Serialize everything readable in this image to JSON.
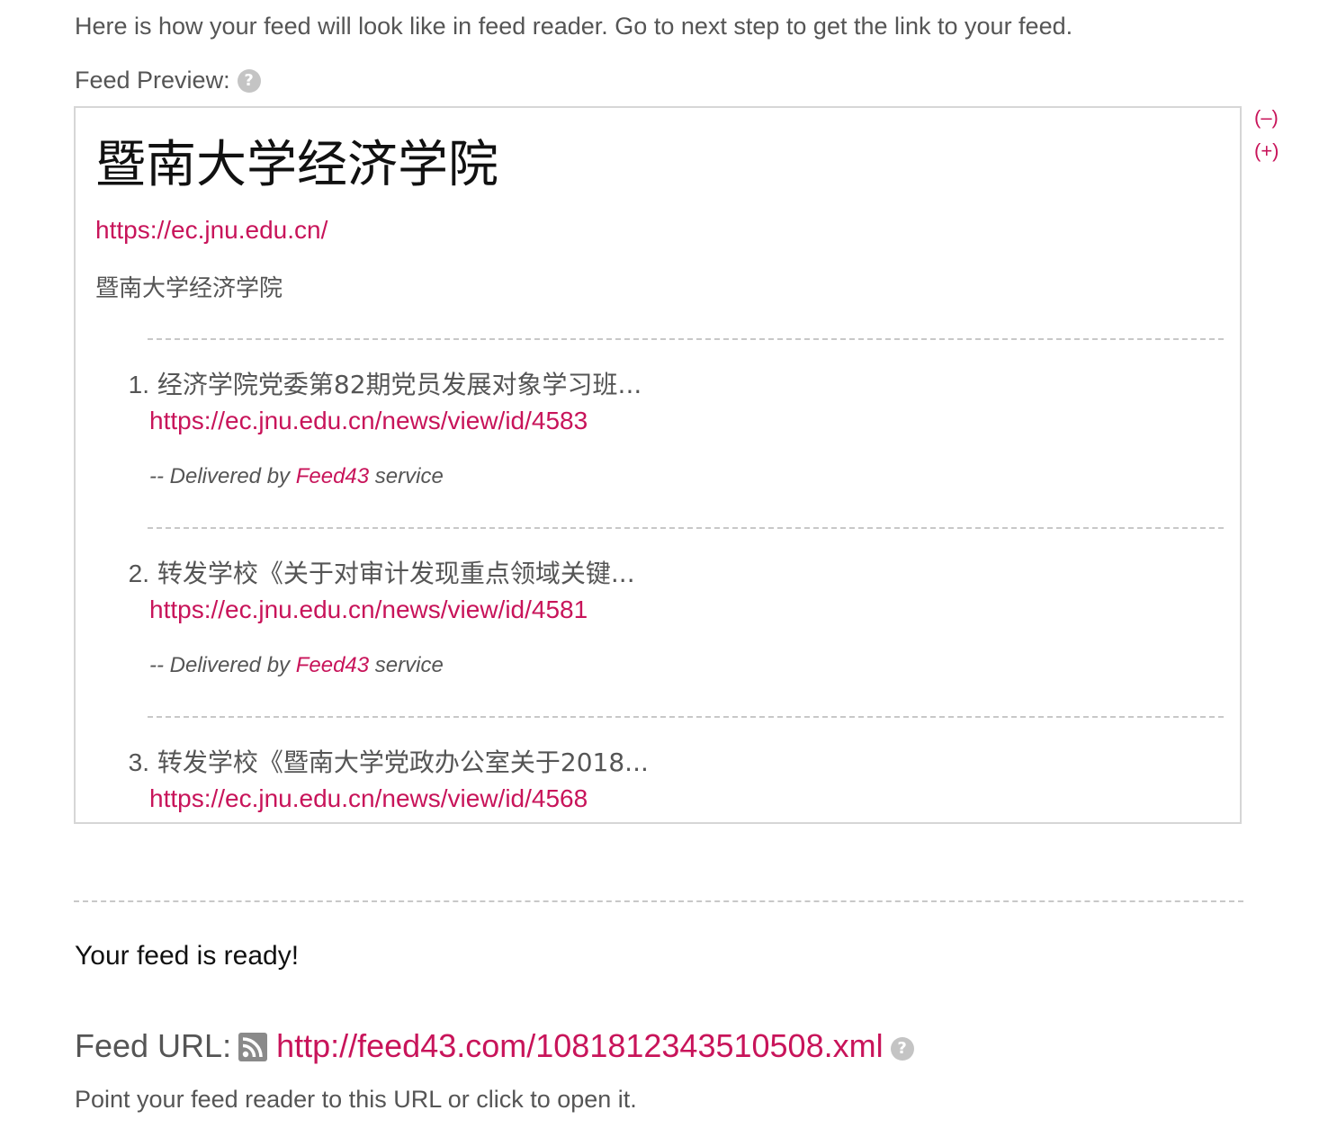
{
  "intro_text": "Here is how your feed will look like in feed reader. Go to next step to get the link to your feed.",
  "preview_label": "Feed Preview:",
  "help_icon_glyph": "?",
  "zoom": {
    "minus": "(–)",
    "plus": "(+)"
  },
  "feed": {
    "title": "暨南大学经济学院",
    "link": "https://ec.jnu.edu.cn/",
    "description": "暨南大学经济学院",
    "items": [
      {
        "number": "1.",
        "title": "经济学院党委第82期党员发展对象学习班...",
        "url": "https://ec.jnu.edu.cn/news/view/id/4583",
        "delivered_prefix": "-- Delivered by ",
        "delivered_link": "Feed43",
        "delivered_suffix": " service"
      },
      {
        "number": "2.",
        "title": "转发学校《关于对审计发现重点领域关键...",
        "url": "https://ec.jnu.edu.cn/news/view/id/4581",
        "delivered_prefix": "-- Delivered by ",
        "delivered_link": "Feed43",
        "delivered_suffix": " service"
      },
      {
        "number": "3.",
        "title": "转发学校《暨南大学党政办公室关于2018...",
        "url": "https://ec.jnu.edu.cn/news/view/id/4568"
      }
    ]
  },
  "ready_text": "Your feed is ready!",
  "feed_url_label": "Feed URL:",
  "feed_url": "http://feed43.com/1081812343510508.xml",
  "hint_text": "Point your feed reader to this URL or click to open it.",
  "icons": {
    "help": "help-icon",
    "rss": "rss-icon"
  },
  "colors": {
    "link": "#c8145a",
    "text": "#555555",
    "icon_gray": "#c4c4c4"
  }
}
